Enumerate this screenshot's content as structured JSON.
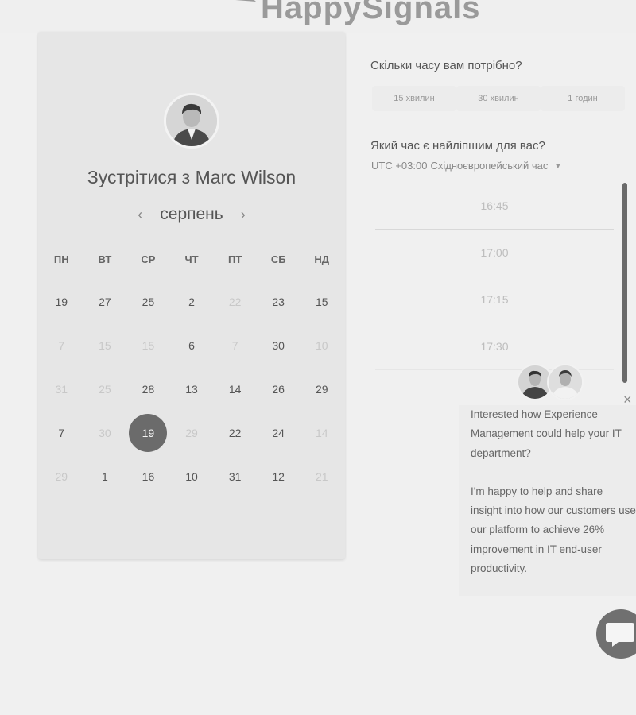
{
  "brand": {
    "name": "HappySignals"
  },
  "card": {
    "title": "Зустрітися з Marc Wilson",
    "month": "серпень",
    "prev": "‹",
    "next": "›",
    "weekdays": [
      "ПН",
      "ВТ",
      "СР",
      "ЧТ",
      "ПТ",
      "СБ",
      "НД"
    ],
    "weeks": [
      [
        {
          "d": "19",
          "s": ""
        },
        {
          "d": "27",
          "s": ""
        },
        {
          "d": "25",
          "s": ""
        },
        {
          "d": "2",
          "s": ""
        },
        {
          "d": "22",
          "s": "disabled"
        },
        {
          "d": "23",
          "s": ""
        },
        {
          "d": "15",
          "s": ""
        }
      ],
      [
        {
          "d": "7",
          "s": "disabled"
        },
        {
          "d": "15",
          "s": "disabled"
        },
        {
          "d": "15",
          "s": "disabled"
        },
        {
          "d": "6",
          "s": ""
        },
        {
          "d": "7",
          "s": "disabled"
        },
        {
          "d": "30",
          "s": ""
        },
        {
          "d": "10",
          "s": "disabled"
        }
      ],
      [
        {
          "d": "31",
          "s": "disabled"
        },
        {
          "d": "25",
          "s": "disabled"
        },
        {
          "d": "28",
          "s": ""
        },
        {
          "d": "13",
          "s": ""
        },
        {
          "d": "14",
          "s": ""
        },
        {
          "d": "26",
          "s": ""
        },
        {
          "d": "29",
          "s": ""
        }
      ],
      [
        {
          "d": "7",
          "s": ""
        },
        {
          "d": "30",
          "s": "disabled"
        },
        {
          "d": "19",
          "s": "selected"
        },
        {
          "d": "29",
          "s": "disabled"
        },
        {
          "d": "22",
          "s": ""
        },
        {
          "d": "24",
          "s": ""
        },
        {
          "d": "14",
          "s": "disabled"
        }
      ],
      [
        {
          "d": "29",
          "s": "disabled"
        },
        {
          "d": "1",
          "s": ""
        },
        {
          "d": "16",
          "s": ""
        },
        {
          "d": "10",
          "s": ""
        },
        {
          "d": "31",
          "s": ""
        },
        {
          "d": "12",
          "s": ""
        },
        {
          "d": "21",
          "s": "disabled"
        }
      ]
    ]
  },
  "right": {
    "duration_question": "Скільки часу вам потрібно?",
    "durations": [
      "15 хвилин",
      "30 хвилин",
      "1 годин"
    ],
    "best_time_question": "Який час є найліпшим для вас?",
    "tz_offset": "UTC +03:00",
    "tz_name": "Східноєвропейський час",
    "slots": [
      "16:45",
      "17:00",
      "17:15",
      "17:30"
    ]
  },
  "chat": {
    "close": "×",
    "paragraph1": "Interested how Experience Management could help your IT department?",
    "paragraph2": "I'm happy to help and share insight into how our customers use our platform to achieve 26% improvement in IT end-user productivity."
  },
  "icons": {
    "logo": "speech-bubble-logo",
    "close": "close-icon",
    "chat": "chat-bubble-icon",
    "dropdown": "caret-down-icon"
  }
}
